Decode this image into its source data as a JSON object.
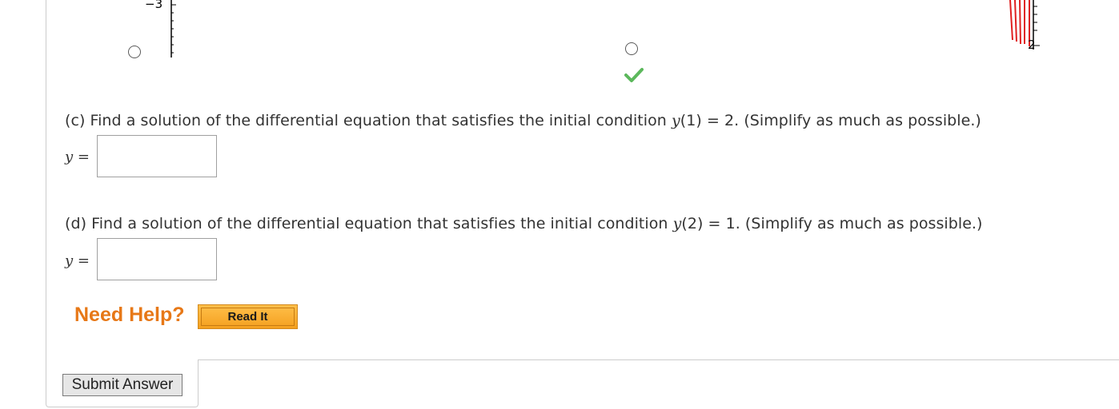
{
  "graphs": {
    "left_tick_label": "−3",
    "right_tick_label": "2"
  },
  "part_c": {
    "prefix": "(c) Find a solution of the differential equation that satisfies the initial condition ",
    "func": "y",
    "condition": "(1) = 2. (Simplify as much as possible.)",
    "answer_label": "y =",
    "answer_value": ""
  },
  "part_d": {
    "prefix": "(d) Find a solution of the differential equation that satisfies the initial condition ",
    "func": "y",
    "condition": "(2) = 1. (Simplify as much as possible.)",
    "answer_label": "y =",
    "answer_value": ""
  },
  "help": {
    "need_help_label": "Need Help?",
    "read_it_label": "Read It"
  },
  "submit_label": "Submit Answer",
  "colors": {
    "accent_orange": "#e77817",
    "check_green": "#5cb85c",
    "graph_red": "#e02020"
  }
}
